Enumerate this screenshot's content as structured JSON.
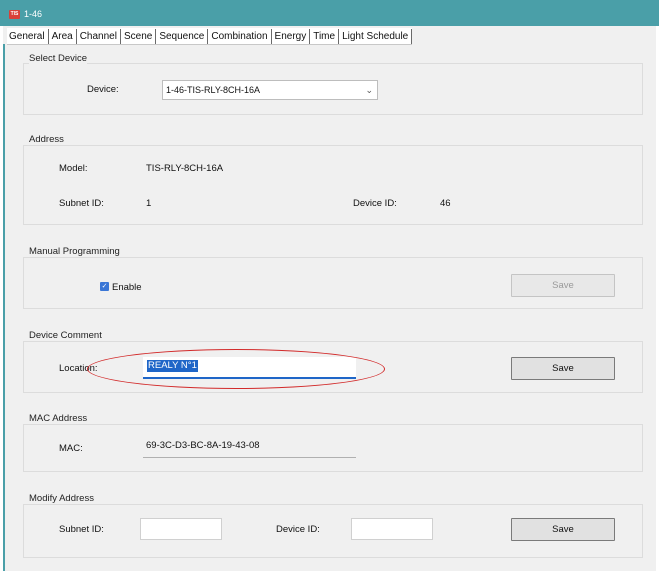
{
  "window": {
    "title": "1-46",
    "icon_text": "TIS"
  },
  "tabs": [
    "General",
    "Area",
    "Channel",
    "Scene",
    "Sequence",
    "Combination",
    "Energy",
    "Time",
    "Light Schedule"
  ],
  "select_device": {
    "group_title": "Select Device",
    "device_label": "Device:",
    "device_value": "1-46-TIS-RLY-8CH-16A"
  },
  "address": {
    "group_title": "Address",
    "model_label": "Model:",
    "model_value": "TIS-RLY-8CH-16A",
    "subnet_label": "Subnet ID:",
    "subnet_value": "1",
    "device_id_label": "Device ID:",
    "device_id_value": "46"
  },
  "manual_programming": {
    "group_title": "Manual Programming",
    "enable_label": "Enable",
    "enable_checked": true,
    "save_label": "Save"
  },
  "device_comment": {
    "group_title": "Device Comment",
    "location_label": "Location:",
    "location_value": "REALY N°1",
    "save_label": "Save"
  },
  "mac_address": {
    "group_title": "MAC Address",
    "mac_label": "MAC:",
    "mac_value": "69-3C-D3-BC-8A-19-43-08"
  },
  "modify_address": {
    "group_title": "Modify Address",
    "subnet_label": "Subnet ID:",
    "subnet_value": "",
    "device_id_label": "Device ID:",
    "device_id_value": "",
    "save_label": "Save"
  },
  "colors": {
    "titlebar": "#4a9fa8",
    "selection": "#1f66c8",
    "annotation": "#d22a2a"
  }
}
